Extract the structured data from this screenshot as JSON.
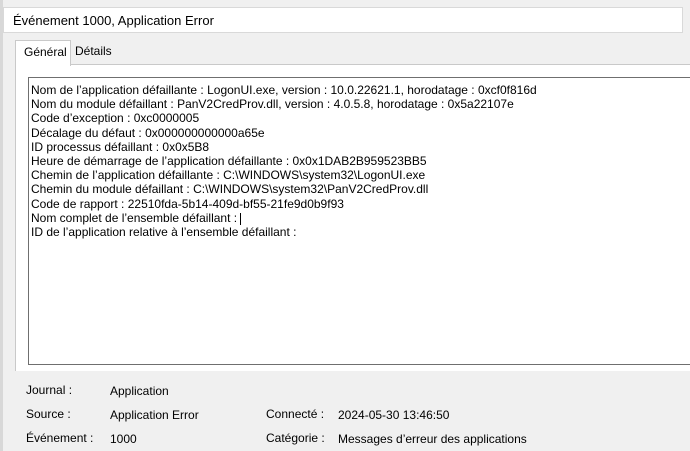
{
  "window": {
    "title": "Événement 1000, Application Error"
  },
  "tabs": [
    {
      "label": "Général",
      "active": true
    },
    {
      "label": "Détails",
      "active": false
    }
  ],
  "description_lines": [
    "Nom de l’application défaillante : LogonUI.exe, version : 10.0.22621.1, horodatage : 0xcf0f816d",
    "Nom du module défaillant : PanV2CredProv.dll, version : 4.0.5.8, horodatage : 0x5a22107e",
    "Code d’exception : 0xc0000005",
    "Décalage du défaut : 0x000000000000a65e",
    "ID processus défaillant : 0x0x5B8",
    "Heure de démarrage de l’application défaillante : 0x0x1DAB2B959523BB5",
    "Chemin de l’application défaillante : C:\\WINDOWS\\system32\\LogonUI.exe",
    "Chemin du module défaillant : C:\\WINDOWS\\system32\\PanV2CredProv.dll",
    "Code de rapport : 22510fda-5b14-409d-bf55-21fe9d0b9f93",
    "Nom complet de l’ensemble défaillant :",
    "ID de l’application relative à l’ensemble défaillant :"
  ],
  "fields": {
    "journal": {
      "label": "Journal :",
      "value": "Application"
    },
    "source": {
      "label": "Source :",
      "value": "Application Error"
    },
    "connecte": {
      "label": "Connecté :",
      "value": "2024-05-30 13:46:50"
    },
    "evenement": {
      "label": "Événement :",
      "value": "1000"
    },
    "categorie": {
      "label": "Catégorie :",
      "value": "Messages d’erreur des applications"
    }
  }
}
